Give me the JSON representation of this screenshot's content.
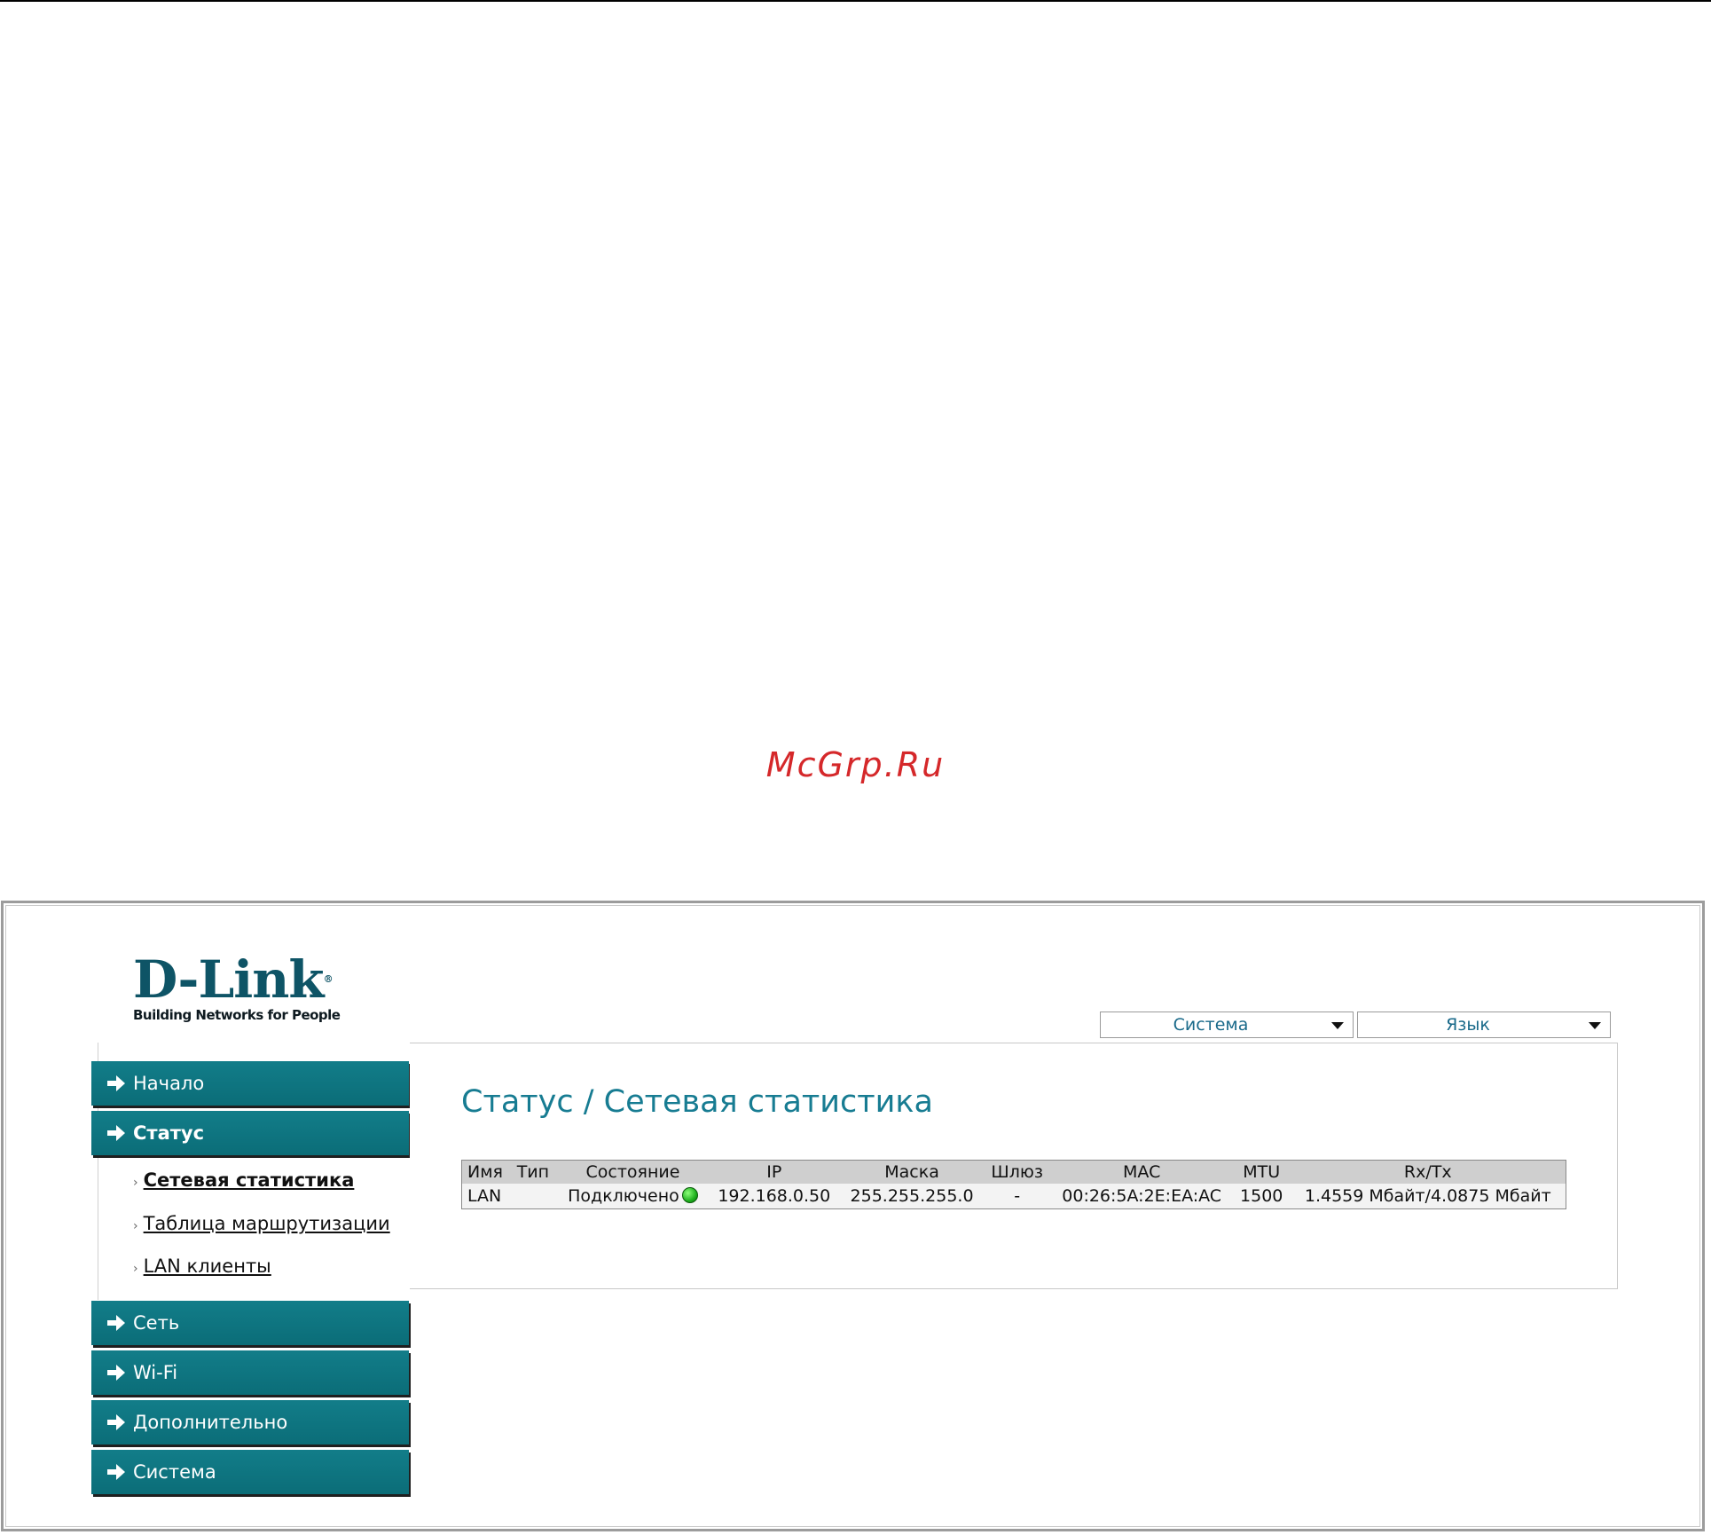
{
  "watermark": "McGrp.Ru",
  "logo": {
    "brand": "D-Link",
    "tagline": "Building Networks for People",
    "reg": "®"
  },
  "header": {
    "dropdowns": [
      {
        "label": "Система"
      },
      {
        "label": "Язык"
      }
    ]
  },
  "sidebar": {
    "items": [
      {
        "label": "Начало",
        "active": false
      },
      {
        "label": "Статус",
        "active": true
      },
      {
        "label": "Сеть",
        "active": false
      },
      {
        "label": "Wi-Fi",
        "active": false
      },
      {
        "label": "Дополнительно",
        "active": false
      },
      {
        "label": "Система",
        "active": false
      }
    ],
    "submenu": [
      {
        "label": "Сетевая статистика",
        "current": true
      },
      {
        "label": "Таблица маршрутизации",
        "current": false
      },
      {
        "label": "LAN клиенты",
        "current": false
      }
    ]
  },
  "main": {
    "title": "Статус / Сетевая статистика",
    "table": {
      "columns": [
        "Имя",
        "Тип",
        "Состояние",
        "IP",
        "Маска",
        "Шлюз",
        "MAC",
        "MTU",
        "Rx/Tx"
      ],
      "rows": [
        {
          "name": "LAN",
          "type": "",
          "state": "Подключено",
          "state_color": "#22c022",
          "ip": "192.168.0.50",
          "mask": "255.255.255.0",
          "gateway": "-",
          "mac": "00:26:5A:2E:EA:AC",
          "mtu": "1500",
          "rxtx": "1.4559 Мбайт/4.0875 Мбайт"
        }
      ]
    }
  }
}
